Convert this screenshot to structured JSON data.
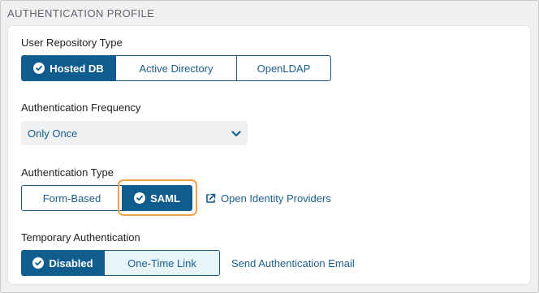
{
  "section": {
    "title": "AUTHENTICATION PROFILE"
  },
  "repository": {
    "label": "User Repository Type",
    "options": [
      "Hosted DB",
      "Active Directory",
      "OpenLDAP"
    ],
    "selected": "Hosted DB"
  },
  "frequency": {
    "label": "Authentication Frequency",
    "value": "Only Once"
  },
  "auth_type": {
    "label": "Authentication Type",
    "options": [
      "Form-Based",
      "SAML"
    ],
    "selected": "SAML",
    "link": "Open Identity Providers"
  },
  "temporary": {
    "label": "Temporary Authentication",
    "options": [
      "Disabled",
      "One-Time Link"
    ],
    "selected": "Disabled",
    "link": "Send Authentication Email"
  },
  "colors": {
    "accent": "#0f5c8f",
    "link": "#1b5e8c",
    "highlight": "#f0a04b"
  },
  "icons": {
    "check": "check-circle-icon",
    "chevron": "chevron-down-icon",
    "external": "external-link-icon"
  }
}
